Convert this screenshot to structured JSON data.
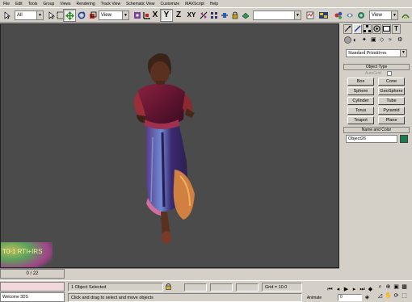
{
  "menu": [
    "File",
    "Edit",
    "Tools",
    "Group",
    "Views",
    "Rendering",
    "Track View",
    "Schematic View",
    "Customize",
    "MAXScript",
    "Help"
  ],
  "toolbar": {
    "selection_filter": "All",
    "ref_coord": "View",
    "named_selection": "",
    "render_coord": "View",
    "axis_x": "X",
    "axis_y": "Y",
    "axis_z": "Z",
    "axis_xy": "XY"
  },
  "command_panel": {
    "category_dropdown": "Standard Primitives",
    "object_type_header": "Object Type",
    "autogrid_label": "AutoGrid",
    "buttons": [
      "Box",
      "Cone",
      "Sphere",
      "GeoSphere",
      "Cylinder",
      "Tube",
      "Torus",
      "Pyramid",
      "Teapot",
      "Plane"
    ],
    "name_color_header": "Name and Color",
    "object_name": "Object26",
    "object_color": "#1a7a50"
  },
  "timeline": {
    "frame_label": "0 / 22"
  },
  "status": {
    "selection_info": "1 Object Selected",
    "prompt": "Click and drag to select and move objects",
    "grid": "Grid = 10.0",
    "animate": "Animate",
    "frame_field": "0",
    "taskbar_item": "Welcome 3DS"
  },
  "viewport": {
    "background": "#4b4b4b",
    "overlay_text": "T0-1 RTI+IRS"
  }
}
